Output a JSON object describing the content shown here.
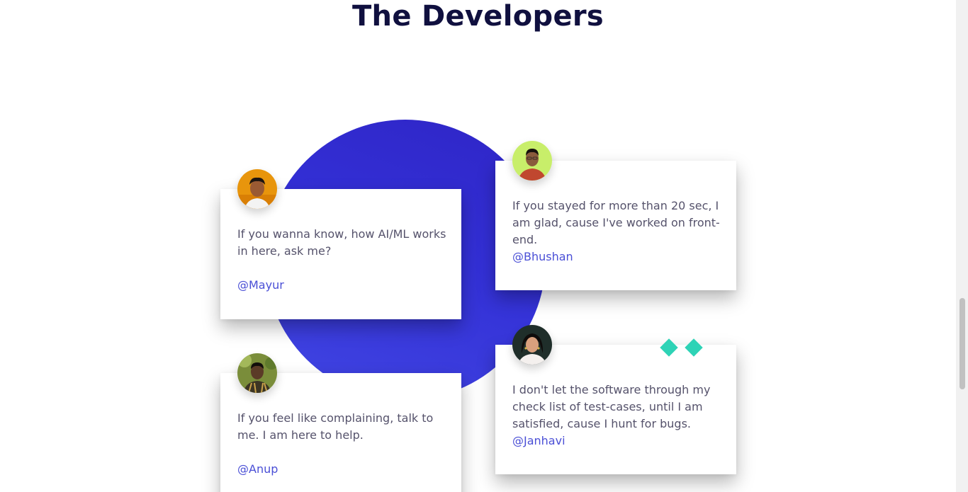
{
  "section": {
    "title": "The Developers"
  },
  "developers": [
    {
      "quote": "If you wanna know, how AI/ML works in here, ask me?",
      "handle": "@Mayur",
      "avatar_icon": "avatar-mayur-icon"
    },
    {
      "quote": "If you stayed for more than 20 sec, I am glad, cause I've worked on front-end.",
      "handle": "@Bhushan",
      "avatar_icon": "avatar-bhushan-icon"
    },
    {
      "quote": "If you feel like complaining, talk to me. I am here to help.",
      "handle": "@Anup",
      "avatar_icon": "avatar-anup-icon"
    },
    {
      "quote": "I don't let the software through my check list of test-cases, until I am satisfied, cause I hunt for bugs.",
      "handle": "@Janhavi",
      "avatar_icon": "avatar-janhavi-icon"
    }
  ],
  "colors": {
    "title": "#10103f",
    "accent_circle": "#3330d6",
    "handle": "#4a4fd6",
    "diamond": "#2ed3b6",
    "text": "#55526b"
  }
}
